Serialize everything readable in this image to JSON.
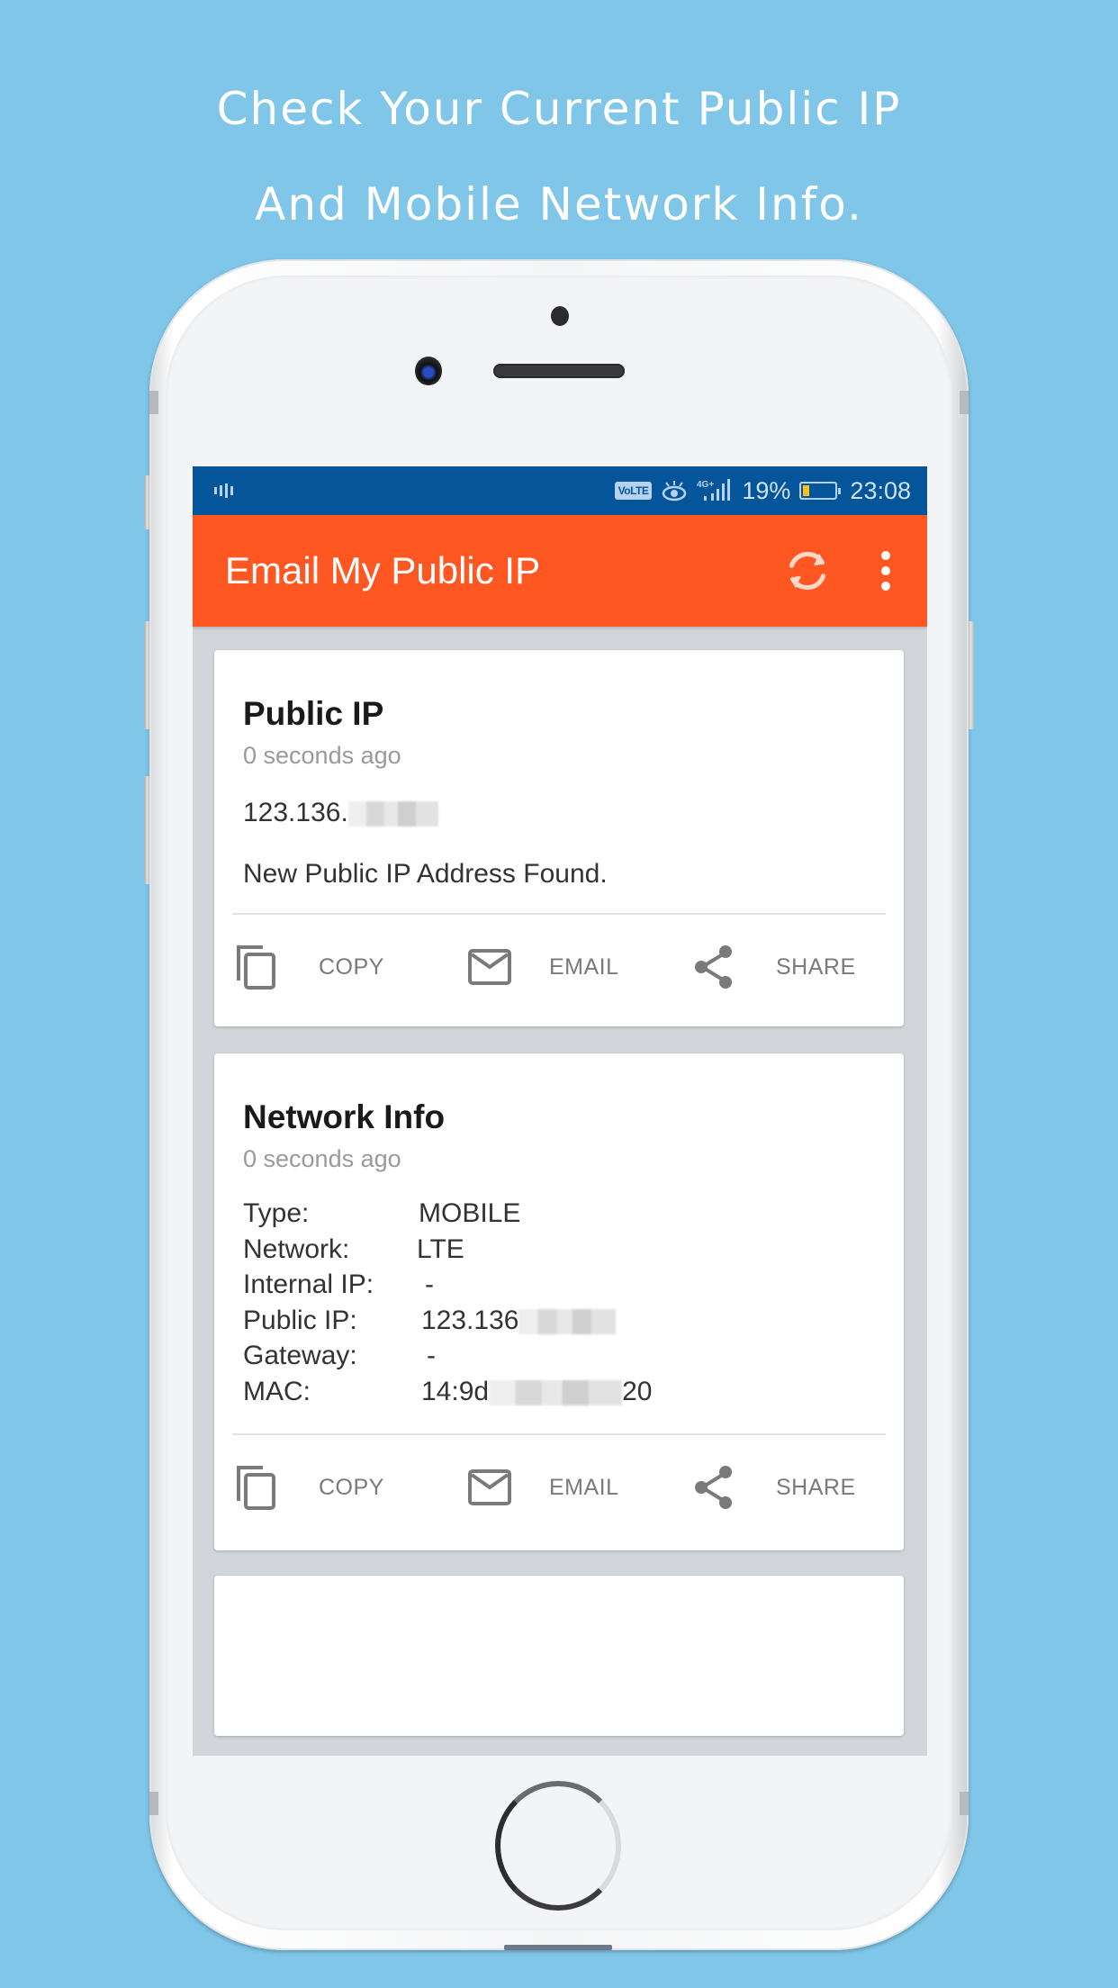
{
  "headline": {
    "line1": "Check Your Current Public IP",
    "line2": "And Mobile Network Info."
  },
  "status_bar": {
    "left_icon": "sound-wave-icon",
    "volte_label": "VoLTE",
    "eye_icon": "eye-comfort-icon",
    "network_label": "4G+",
    "signal_icon": "signal-bars-icon",
    "battery_percent": "19%",
    "battery_level": 0.19,
    "battery_color": "#f7c21a",
    "time": "23:08"
  },
  "app_bar": {
    "title": "Email My Public IP",
    "refresh_icon": "refresh-icon",
    "menu_icon": "more-vert-icon",
    "color": "#ff5722"
  },
  "colors": {
    "status_bar": "#04559a",
    "app_bar": "#ff5722",
    "background": "#7fc6e8",
    "screen_bg": "#d2d6da"
  },
  "public_ip_card": {
    "title": "Public IP",
    "updated": "0 seconds ago",
    "ip_visible": "123.136.",
    "ip_redacted": true,
    "message": "New Public IP Address Found.",
    "actions": [
      {
        "label": "COPY",
        "icon": "copy-icon"
      },
      {
        "label": "EMAIL",
        "icon": "email-icon"
      },
      {
        "label": "SHARE",
        "icon": "share-icon"
      }
    ]
  },
  "network_card": {
    "title": "Network Info",
    "updated": "0 seconds ago",
    "rows": [
      {
        "key": "Type:",
        "value": "MOBILE"
      },
      {
        "key": "Network:",
        "value": "LTE"
      },
      {
        "key": "Internal IP:",
        "value": "-"
      },
      {
        "key": "Public IP:",
        "value": "123.136",
        "redacted_suffix": true
      },
      {
        "key": "Gateway:",
        "value": "-"
      },
      {
        "key": "MAC:",
        "value": "14:9d",
        "redacted_middle": true,
        "value_end": "20"
      }
    ],
    "actions": [
      {
        "label": "COPY",
        "icon": "copy-icon"
      },
      {
        "label": "EMAIL",
        "icon": "email-icon"
      },
      {
        "label": "SHARE",
        "icon": "share-icon"
      }
    ]
  }
}
